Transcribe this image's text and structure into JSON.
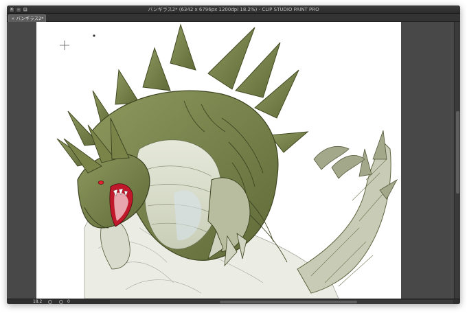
{
  "window": {
    "title": "バンギラス2* (6342 x 6796px 1200dpi 18.2%)  - CLIP STUDIO PAINT PRO"
  },
  "tabs": [
    {
      "label": "バンギラス2*",
      "close_glyph": "×"
    }
  ],
  "status": {
    "zoom": "18.2",
    "angle": "0"
  },
  "icons": {
    "close": "close-icon",
    "minimize": "minimize-icon",
    "maximize": "maximize-icon"
  },
  "colors": {
    "canvas_bg": "#484848",
    "paper": "#ffffff",
    "body_green": "#7f8a52",
    "belly": "#d9ddc8",
    "mouth_red": "#c0182a"
  },
  "artwork": {
    "subject": "dragon-illustration"
  }
}
